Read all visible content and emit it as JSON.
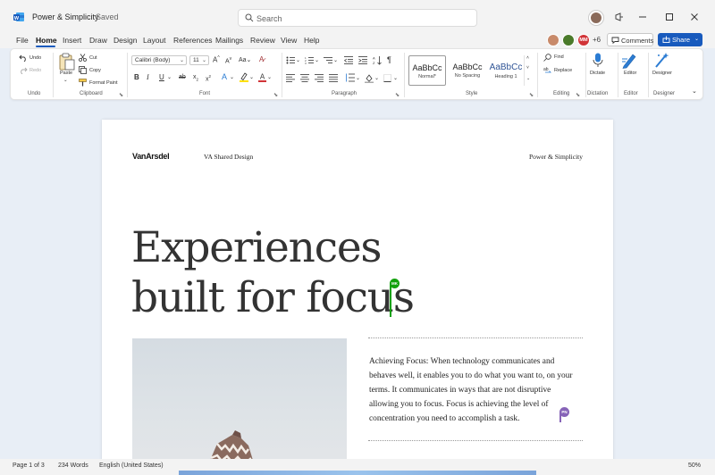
{
  "titlebar": {
    "doc_title": "Power & Simplicity",
    "saved_status": "Saved",
    "search_placeholder": "Search"
  },
  "menu": {
    "items": [
      "File",
      "Home",
      "Insert",
      "Draw",
      "Design",
      "Layout",
      "References",
      "Mailings",
      "Review",
      "View",
      "Help"
    ],
    "active": "Home"
  },
  "collaborators": {
    "initials": [
      "",
      "",
      "MM"
    ],
    "extra_count": "+6",
    "colors": [
      "#c88a6a",
      "#4a7a2a",
      "#d13438"
    ]
  },
  "actions": {
    "comments": "Comments",
    "share": "Share"
  },
  "ribbon": {
    "undo": {
      "undo": "Undo",
      "redo": "Redo",
      "group": "Undo"
    },
    "clipboard": {
      "paste": "Paste",
      "cut": "Cut",
      "copy": "Copy",
      "format_painter": "Format Paint",
      "group": "Clipboard"
    },
    "font": {
      "family": "Calibri (Body)",
      "size": "11",
      "group": "Font"
    },
    "paragraph": {
      "group": "Paragraph"
    },
    "styles": {
      "items": [
        {
          "sample": "AaBbCc",
          "name": "Normal*"
        },
        {
          "sample": "AaBbCc",
          "name": "No Spacing"
        },
        {
          "sample": "AaBbCc",
          "name": "Heading 1"
        }
      ],
      "group": "Style"
    },
    "editing": {
      "find": "Find",
      "replace": "Replace",
      "group": "Editing"
    },
    "dictation": {
      "label": "Dictate",
      "group": "Dictation"
    },
    "editor": {
      "label": "Editor",
      "group": "Editor"
    },
    "designer": {
      "label": "Designer",
      "group": "Designer"
    }
  },
  "document": {
    "logo": "VanArsdel",
    "header_center": "VA Shared Design",
    "header_right": "Power & Simplicity",
    "headline_line1": "Experiences",
    "headline_line2": "built for focus",
    "body": "Achieving Focus: When technology communicates and behaves well, it enables you to do what you want to, on your terms. It communicates in ways that are not disruptive allowing you to focus. Focus is achieving the level of concentration you need to accomplish a task.",
    "cursor_1": {
      "initials": "MK",
      "color": "#13a10e"
    },
    "cursor_2": {
      "initials": "PN",
      "color": "#8764b8"
    }
  },
  "status": {
    "page": "Page 1 of 3",
    "words": "234 Words",
    "language": "English (United States)",
    "zoom": "50%"
  }
}
